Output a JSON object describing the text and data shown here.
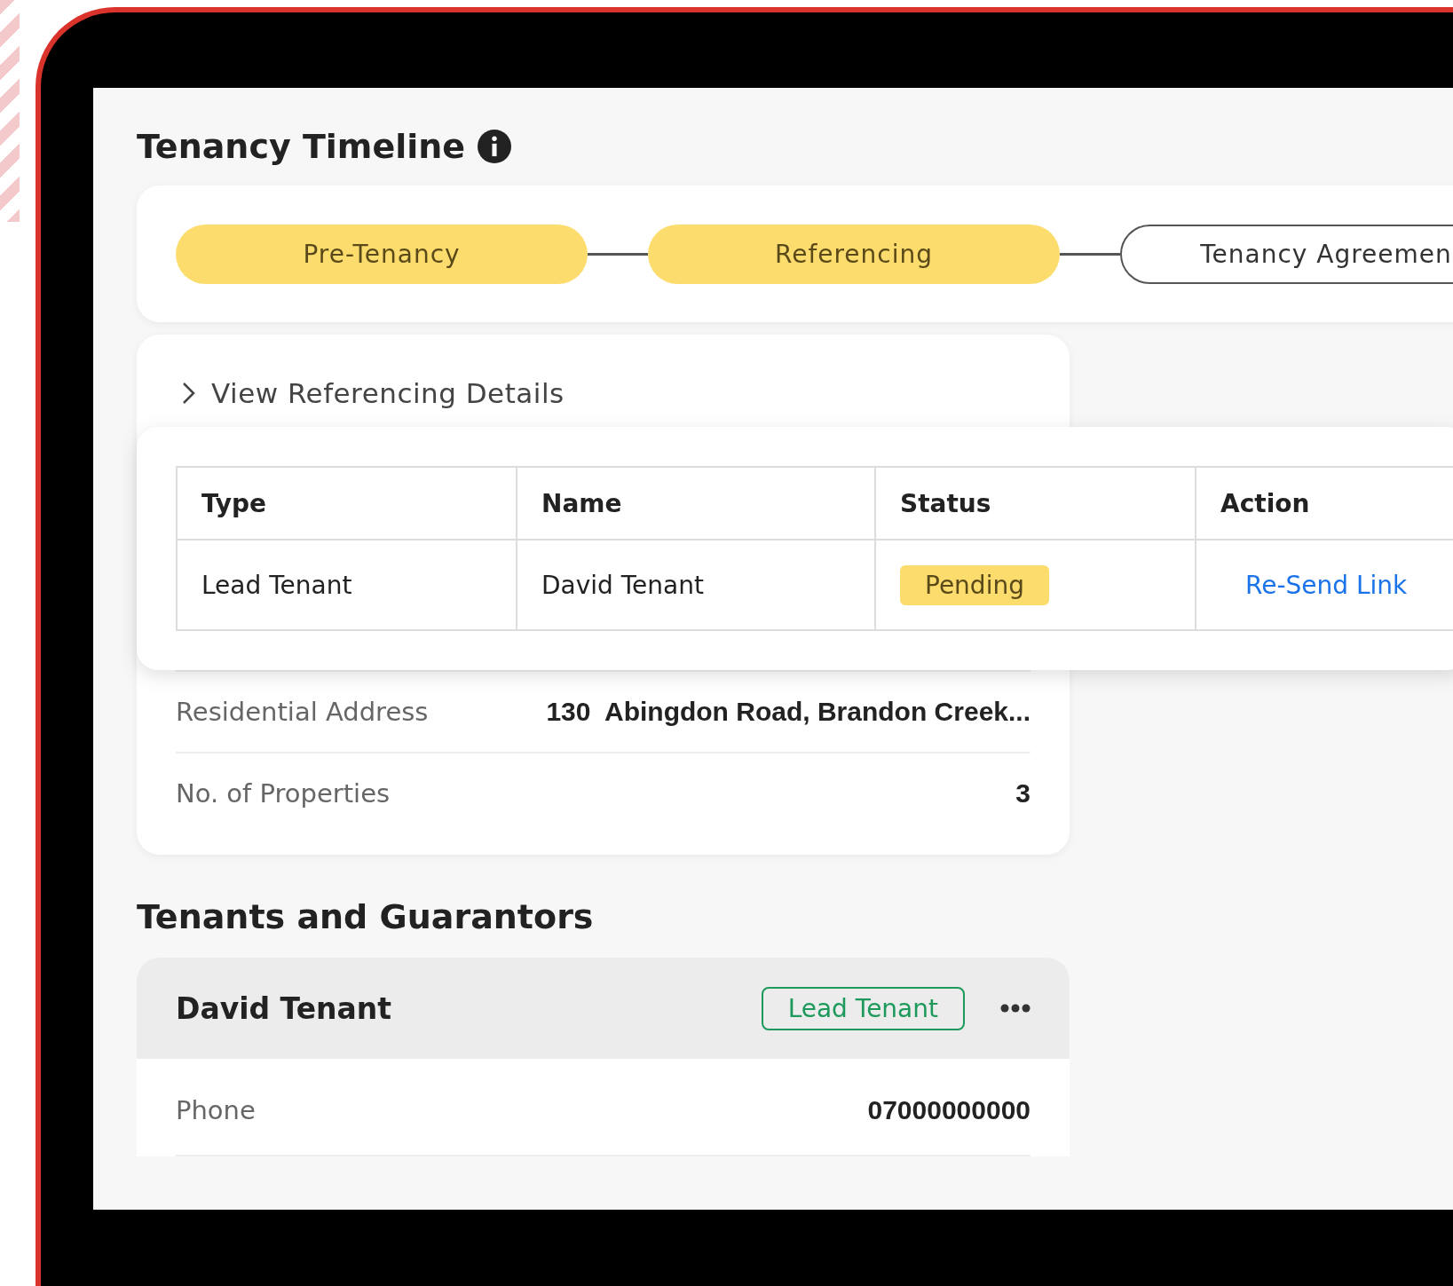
{
  "title": "Tenancy Timeline",
  "timeline": [
    {
      "label": "Pre-Tenancy",
      "completed": true
    },
    {
      "label": "Referencing",
      "completed": true
    },
    {
      "label": "Tenancy Agreemen",
      "completed": false
    }
  ],
  "referencing": {
    "toggle": "View Referencing Details",
    "columns": [
      "Type",
      "Name",
      "Status",
      "Action"
    ],
    "rows": [
      {
        "type": "Lead Tenant",
        "name": "David Tenant",
        "status": "Pending",
        "action": "Re-Send Link"
      }
    ]
  },
  "details": [
    {
      "label": "Residential Address",
      "value": "130  Abingdon Road, Brandon Creek..."
    },
    {
      "label": "No. of Properties",
      "value": "3"
    }
  ],
  "section_title": "Tenants and Guarantors",
  "tenants": [
    {
      "name": "David Tenant",
      "role": "Lead Tenant",
      "fields": [
        {
          "label": "Phone",
          "value": "07000000000"
        }
      ]
    }
  ]
}
